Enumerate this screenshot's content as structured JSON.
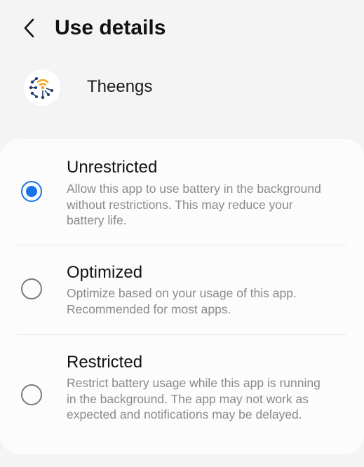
{
  "header": {
    "title": "Use details",
    "back_icon": "chevron-left-icon"
  },
  "app": {
    "name": "Theengs",
    "icon": "theengs-logo-icon"
  },
  "options": [
    {
      "title": "Unrestricted",
      "description": "Allow this app to use battery in the background without restrictions. This may reduce your battery life.",
      "selected": true
    },
    {
      "title": "Optimized",
      "description": "Optimize based on your usage of this app. Recommended for most apps.",
      "selected": false
    },
    {
      "title": "Restricted",
      "description": "Restrict battery usage while this app is running in the background. The app may not work as expected and notifications may be delayed.",
      "selected": false
    }
  ],
  "colors": {
    "accent": "#1a73e8",
    "background": "#f4f4f4",
    "card": "#fcfcfc",
    "secondary_text": "#8a8a8a",
    "logo_orange": "#f5a623",
    "logo_navy": "#1f3a6e"
  }
}
